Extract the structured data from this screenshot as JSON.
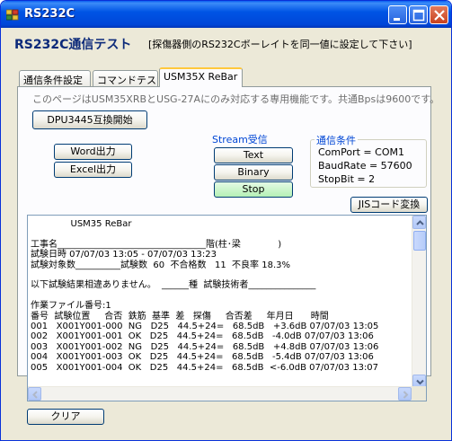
{
  "window": {
    "title": "RS232C"
  },
  "header": {
    "title": "RS232C通信テスト",
    "note": "[探傷器側のRS232Cボーレイトを同一値に設定して下さい]"
  },
  "tabs": [
    {
      "label": "通信条件設定"
    },
    {
      "label": "コマンドテスト"
    },
    {
      "label": "USM35X ReBar"
    }
  ],
  "active_tab_index": 2,
  "panel": {
    "info": "このページはUSM35XRBとUSG-27Aにのみ対応する専用機能です。共通Bpsは9600です。",
    "dpu_button": "DPU3445互換開始",
    "word_button": "Word出力",
    "excel_button": "Excel出力",
    "jis_button": "JISコード変換",
    "clear_button": "クリア"
  },
  "stream": {
    "label": "Stream受信",
    "text_button": "Text",
    "binary_button": "Binary",
    "stop_button": "Stop",
    "active_button_color": "#B5F0B5"
  },
  "comm": {
    "label": "通信条件",
    "port": "ComPort  = COM1",
    "baud": "BaudRate = 57600",
    "stop": "StopBit  = 2"
  },
  "output": {
    "lines": [
      "              USM35 ReBar",
      "",
      "工事名_________________________________階(柱･梁             )",
      "試験日時 07/07/03 13:05 - 07/07/03 13:23",
      "試験対象数__________試験数  60  不合格数   11  不良率 18.3%",
      "",
      "以下試験結果相違ありません。  ______種  試験技術者_______________",
      "",
      "作業ファイル番号:1",
      "番号  試験位置     合否  鉄筋  基準  差   探傷     合否差     年月日      時間",
      "001   X001Y001-000  NG   D25   44.5+24=   68.5dB   +3.6dB 07/07/03 13:05",
      "002   X001Y001-001  OK   D25   44.5+24=   68.5dB   -4.0dB 07/07/03 13:06",
      "003   X001Y001-002  NG   D25   44.5+24=   68.5dB   +4.8dB 07/07/03 13:06",
      "004   X001Y001-003  OK   D25   44.5+24=   68.5dB   -5.4dB 07/07/03 13:06",
      "005   X001Y001-004  OK   D25   44.5+24=   68.5dB  <-6.0dB 07/07/03 13:07"
    ]
  },
  "colors": {
    "title_bar": "#0055E5",
    "header_title": "#0C2A7A",
    "group_label": "#0046D5",
    "info_text": "#6E6E6E"
  }
}
